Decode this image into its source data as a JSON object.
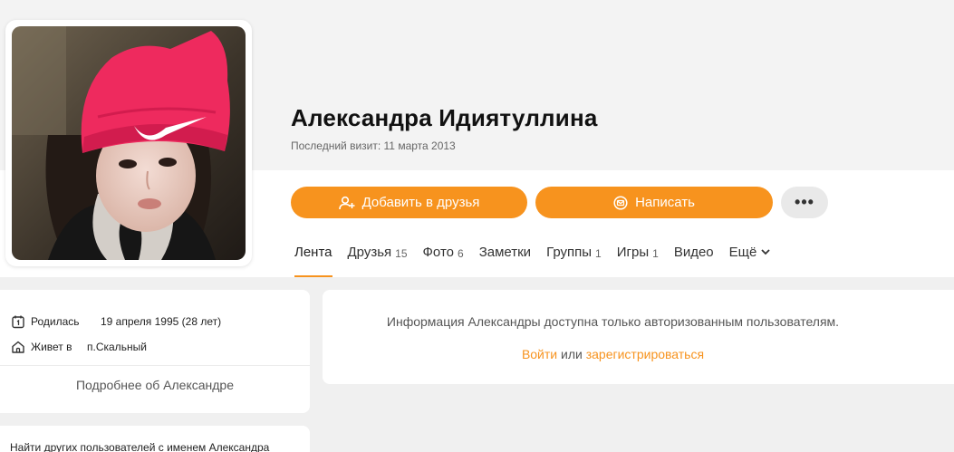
{
  "profile": {
    "name": "Александра Идиятуллина",
    "last_visit": "Последний визит: 11 марта 2013"
  },
  "actions": {
    "add_friend": "Добавить в друзья",
    "write": "Написать",
    "more": "•••"
  },
  "tabs": [
    {
      "label": "Лента",
      "count": ""
    },
    {
      "label": "Друзья",
      "count": "15"
    },
    {
      "label": "Фото",
      "count": "6"
    },
    {
      "label": "Заметки",
      "count": ""
    },
    {
      "label": "Группы",
      "count": "1"
    },
    {
      "label": "Игры",
      "count": "1"
    },
    {
      "label": "Видео",
      "count": ""
    },
    {
      "label": "Ещё",
      "count": ""
    }
  ],
  "info": {
    "born_label": "Родилась",
    "born_value": "19 апреля 1995 (28 лет)",
    "lives_label": "Живет в",
    "lives_value": "п.Скальный",
    "more_about": "Подробнее об Александре"
  },
  "notice": {
    "text": "Информация Александры доступна только авторизованным пользователям.",
    "login": "Войти",
    "or": " или ",
    "register": "зарегистрироваться"
  },
  "find_others": "Найти других пользователей с именем Александра",
  "colors": {
    "accent": "#f7931e",
    "page_bg": "#f0f0f0",
    "card_bg": "#ffffff"
  },
  "icons": {
    "add_friend": "add-user-icon",
    "write": "envelope-icon",
    "born": "calendar-icon",
    "lives": "home-icon",
    "more_tab": "chevron-down-icon"
  }
}
